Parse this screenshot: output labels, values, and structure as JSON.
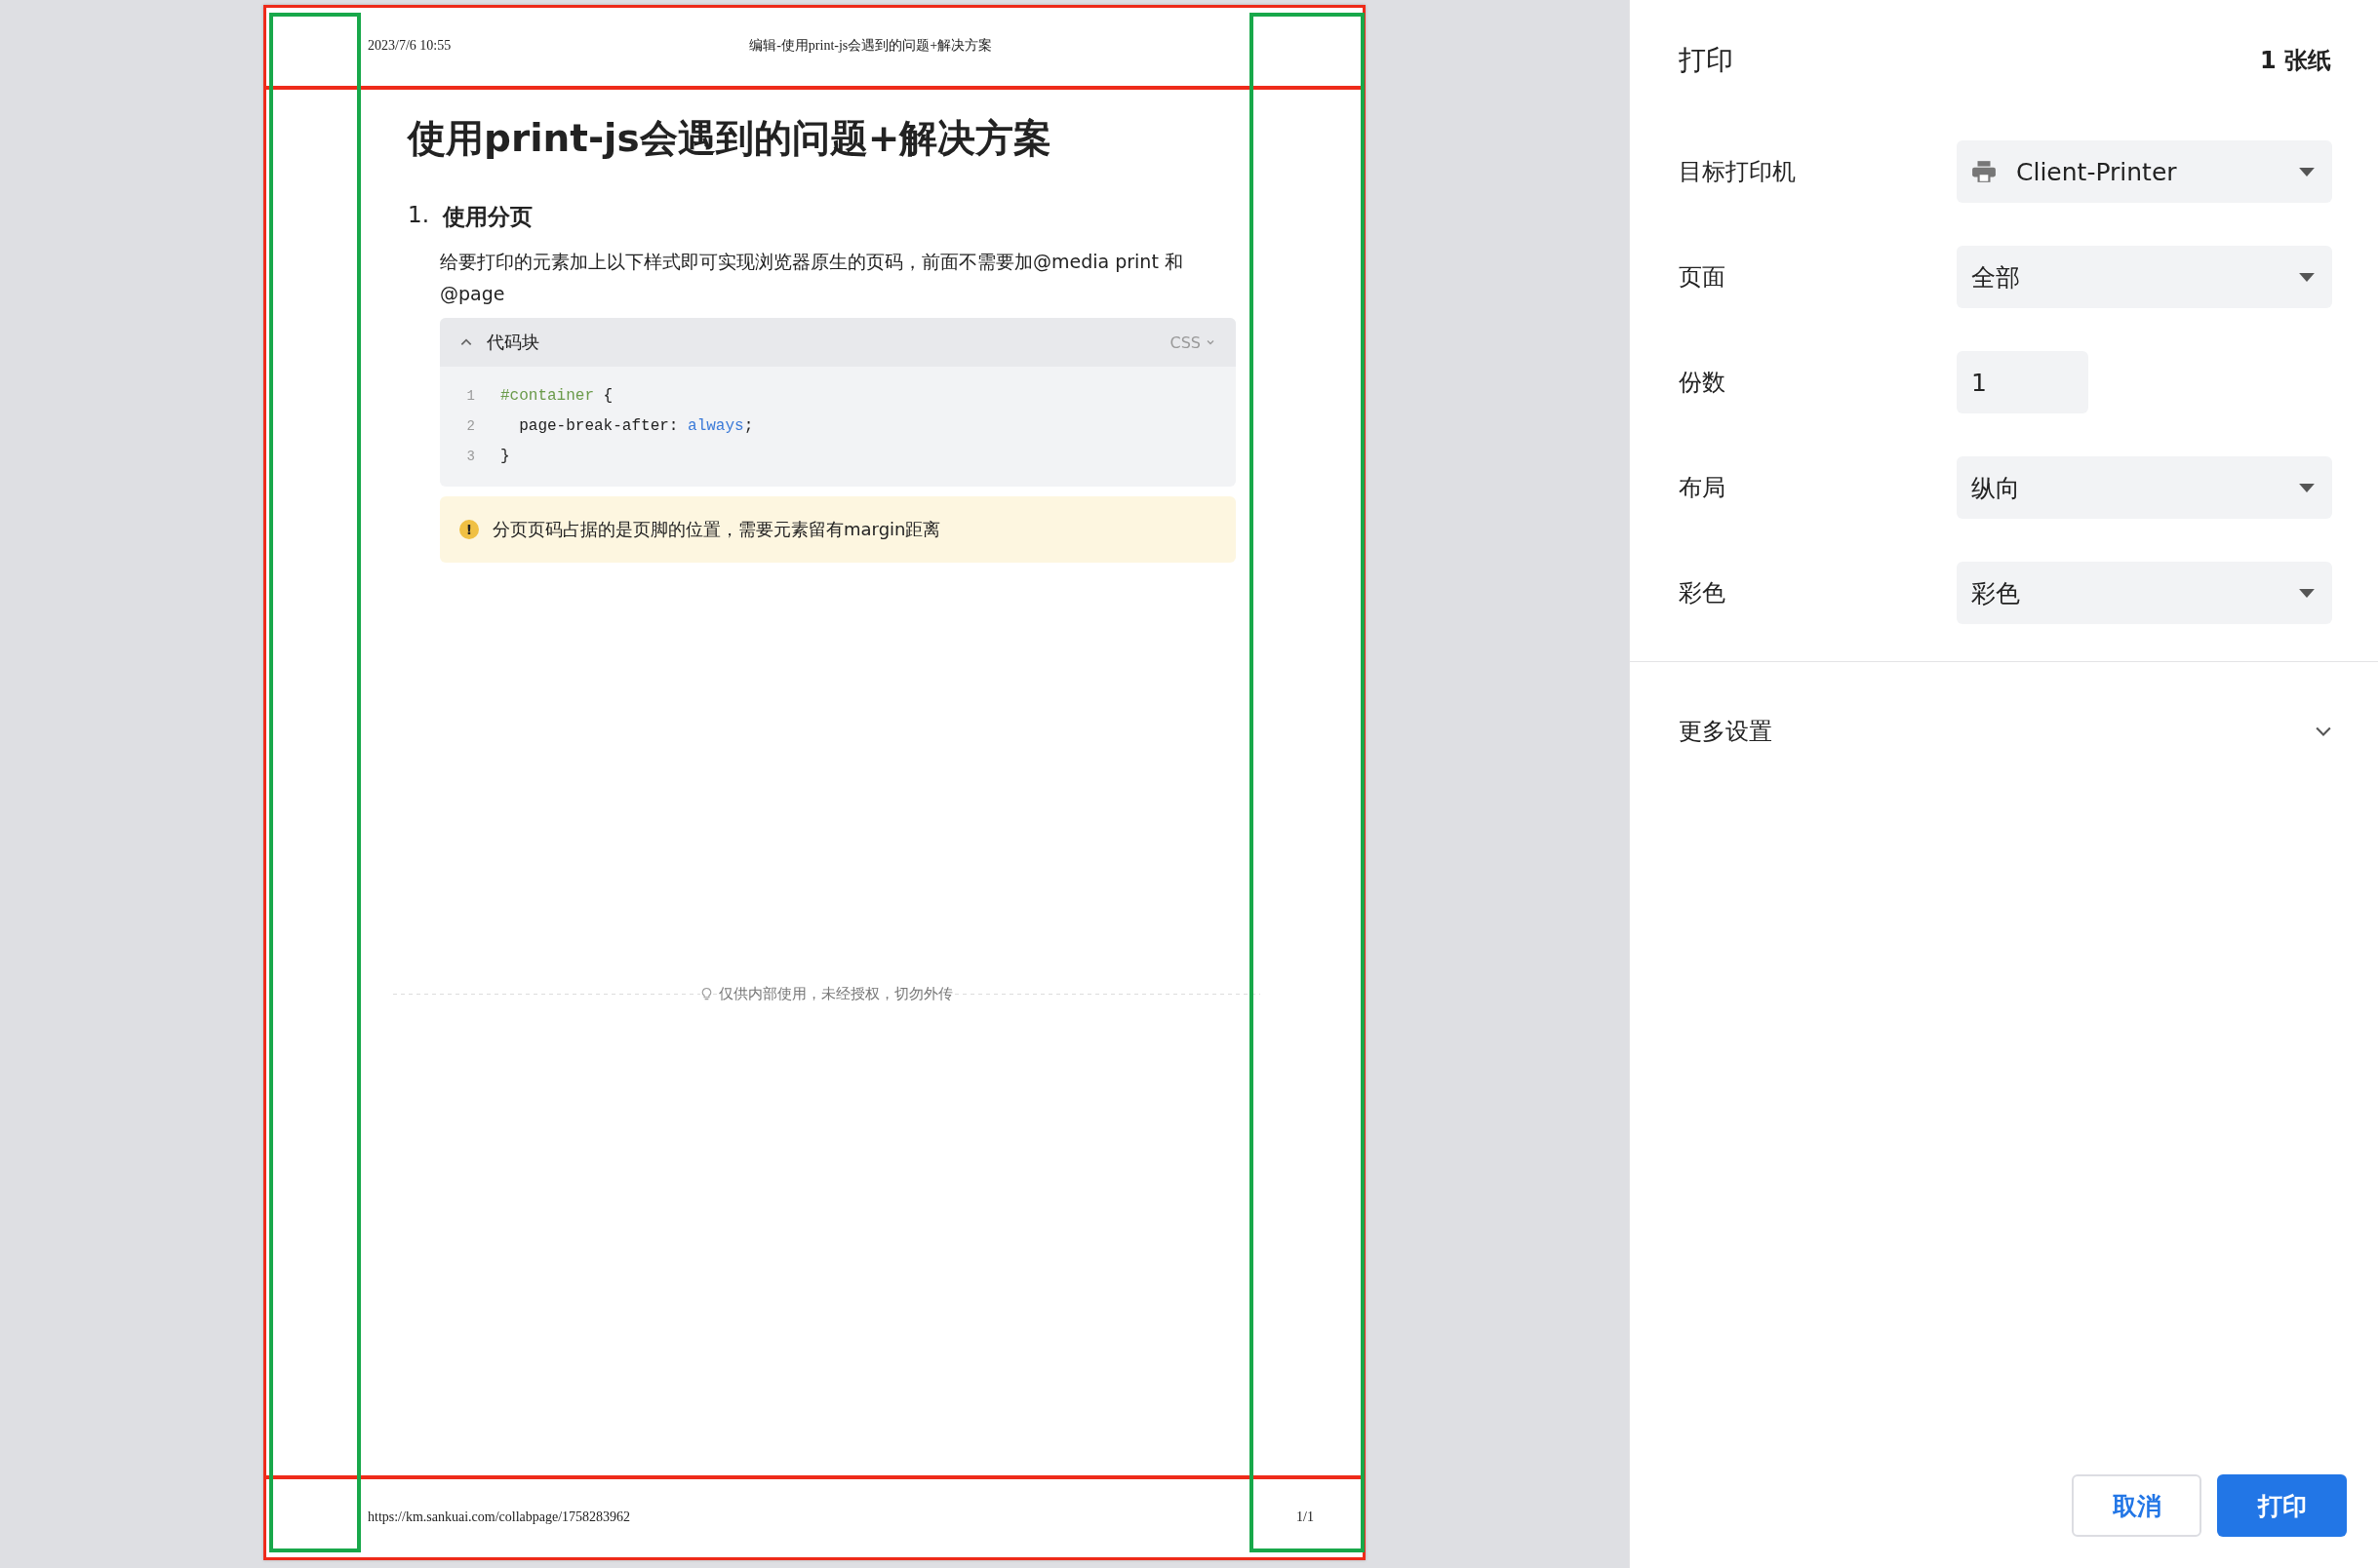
{
  "preview": {
    "header": {
      "date": "2023/7/6 10:55",
      "title": "编辑-使用print-js会遇到的问题+解决方案"
    },
    "document": {
      "title": "使用print-js会遇到的问题+解决方案",
      "section": {
        "number": "1.",
        "heading": "使用分页"
      },
      "paragraph": "给要打印的元素加上以下样式即可实现浏览器原生的页码，前面不需要加@media print 和 @page",
      "code_block": {
        "title": "代码块",
        "expanded": true,
        "language": "CSS",
        "lines": [
          {
            "number": "1",
            "tokens": [
              {
                "text": "#container",
                "kind": "selector"
              },
              {
                "text": " {",
                "kind": "plain"
              }
            ]
          },
          {
            "number": "2",
            "tokens": [
              {
                "text": "  page-break-after: ",
                "kind": "plain"
              },
              {
                "text": "always",
                "kind": "value"
              },
              {
                "text": ";",
                "kind": "plain"
              }
            ]
          },
          {
            "number": "3",
            "tokens": [
              {
                "text": "}",
                "kind": "plain"
              }
            ]
          }
        ]
      },
      "tip": {
        "icon": "!",
        "text": "分页页码占据的是页脚的位置，需要元素留有margin距离"
      },
      "notice": "仅供内部使用，未经授权，切勿外传"
    },
    "footer": {
      "url": "https://km.sankuai.com/collabpage/1758283962",
      "page": "1/1"
    }
  },
  "panel": {
    "title": "打印",
    "sheets": "1 张纸",
    "settings": [
      {
        "label": "目标打印机",
        "kind": "printer-select",
        "value": "Client-Printer"
      },
      {
        "label": "页面",
        "kind": "select",
        "value": "全部"
      },
      {
        "label": "份数",
        "kind": "number",
        "value": "1"
      },
      {
        "label": "布局",
        "kind": "select",
        "value": "纵向"
      },
      {
        "label": "彩色",
        "kind": "select",
        "value": "彩色"
      }
    ],
    "more_settings": {
      "label": "更多设置",
      "expanded": false
    },
    "buttons": [
      {
        "label": "取消",
        "kind": "secondary"
      },
      {
        "label": "打印",
        "kind": "primary"
      }
    ]
  }
}
